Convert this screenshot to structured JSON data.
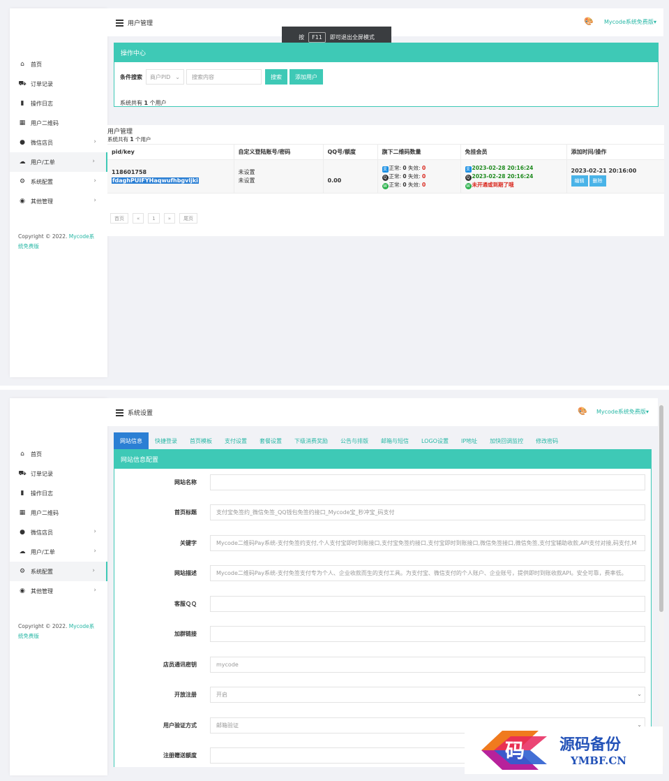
{
  "colors": {
    "accent": "#3ec9b6",
    "link": "#27b7a5",
    "tab_active": "#2b7fd4",
    "danger": "#d9261c",
    "success": "#1e8a1e"
  },
  "sidebar": {
    "items": [
      {
        "label": "首页",
        "icon": "home-icon"
      },
      {
        "label": "订单记录",
        "icon": "cart-icon"
      },
      {
        "label": "操作日志",
        "icon": "book-icon"
      },
      {
        "label": "用户二维码",
        "icon": "qrcode-icon"
      },
      {
        "label": "微信店员",
        "icon": "wechat-icon",
        "arrow": "›"
      },
      {
        "label": "用户/工单",
        "icon": "cloud-icon",
        "arrow": "›"
      },
      {
        "label": "系统配置",
        "icon": "gear-icon",
        "arrow": "›"
      },
      {
        "label": "其他管理",
        "icon": "compass-icon",
        "arrow": "›"
      }
    ],
    "copyright_prefix": "Copyright © 2022. ",
    "copyright_brand": "Mycode系统免费版"
  },
  "shot1": {
    "header": {
      "title": "用户管理",
      "user": "Mycode系统免费版"
    },
    "f11_tip": {
      "prefix": "按",
      "key": "F11",
      "suffix": "即可退出全屏模式"
    },
    "ops_panel": {
      "title": "操作中心",
      "search_label": "条件搜索",
      "select_value": "商户PID",
      "search_placeholder": "搜索内容",
      "search_button": "搜索",
      "add_button": "添加用户",
      "count_prefix": "系统共有",
      "count": "1",
      "count_suffix": "个用户"
    },
    "list": {
      "title": "用户管理",
      "sub_prefix": "系统共有",
      "sub_count": "1",
      "sub_suffix": "个用户",
      "columns": [
        "pid/key",
        "自定义登陆账号/密码",
        "QQ号/额度",
        "旗下二维码数量",
        "免挂会员",
        "添加时间/操作"
      ],
      "row": {
        "pid": "118601758",
        "key": "fdaghPUIFYHaqwufhbgvljki",
        "account": "未设置",
        "password": "未设置",
        "quota": "0.00",
        "qr_lines": [
          {
            "icon": "alipay-icon",
            "label": "正常:",
            "normal": "0",
            "fail_label": "失效:",
            "fail": "0"
          },
          {
            "icon": "qq-icon",
            "label": "正常:",
            "normal": "0",
            "fail_label": "失效:",
            "fail": "0"
          },
          {
            "icon": "wechat-icon",
            "label": "正常:",
            "normal": "0",
            "fail_label": "失效:",
            "fail": "0"
          }
        ],
        "vip_alipay": "2023-02-28 20:16:24",
        "vip_qq": "2023-02-28 20:16:24",
        "vip_wechat": "未开通或到期了哦",
        "added": "2023-02-21 20:16:00",
        "edit": "编辑",
        "delete": "删除"
      },
      "pager": [
        "首页",
        "«",
        "1",
        "»",
        "尾页"
      ]
    }
  },
  "shot2": {
    "header": {
      "title": "系统设置",
      "user": "Mycode系统免费版"
    },
    "tabs": [
      "网站信息",
      "快捷登录",
      "首页模板",
      "支付设置",
      "套餐设置",
      "下级消费奖励",
      "公告与排版",
      "邮箱与短信",
      "LOGO设置",
      "IP地址",
      "加快回调监控",
      "修改密码"
    ],
    "panel_title": "网站信息配置",
    "fields": [
      {
        "label": "网站名称",
        "value": ""
      },
      {
        "label": "首页标题",
        "value": "支付宝免签约_微信免签_QQ钱包免签约接口_Mycode宝_秒冲宝_码支付"
      },
      {
        "label": "关键字",
        "value": "Mycode二维码Pay系统-支付免签约支付,个人支付宝即时到账接口,支付宝免签约接口,支付宝即时到账接口,微信免签接口,微信免签,支付宝辅助收款,API支付对接,码支付,M"
      },
      {
        "label": "网站描述",
        "value": "Mycode二维码Pay系统-支付免签支付专为个人、企业收款而生的支付工具。为支付宝、微信支付的个人账户、企业账号，提供即时到账收款API。安全可靠，费率低。"
      },
      {
        "label": "客服ＱＱ",
        "value": ""
      },
      {
        "label": "加群链接",
        "value": ""
      },
      {
        "label": "店员通讯密钥",
        "value": "mycode"
      },
      {
        "label": "开放注册",
        "value": "开启",
        "select": true
      },
      {
        "label": "用户验证方式",
        "value": "邮箱验证",
        "select": true
      },
      {
        "label": "注册赠送额度",
        "value": ""
      }
    ]
  },
  "watermark": {
    "logo_char": "码",
    "cn": "源码备份",
    "en": "YMBF.CN"
  }
}
